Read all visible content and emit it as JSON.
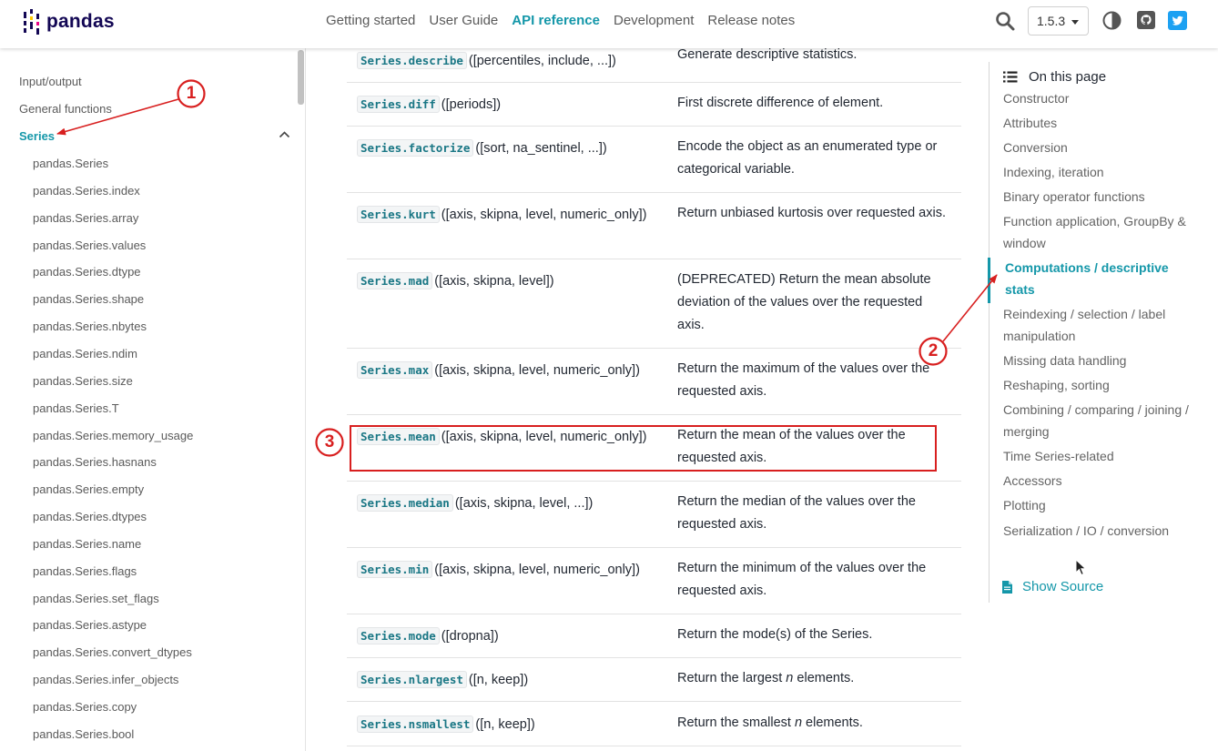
{
  "navbar": {
    "logo_text": "pandas",
    "links": [
      {
        "label": "Getting started",
        "active": false
      },
      {
        "label": "User Guide",
        "active": false
      },
      {
        "label": "API reference",
        "active": true
      },
      {
        "label": "Development",
        "active": false
      },
      {
        "label": "Release notes",
        "active": false
      }
    ],
    "version": "1.5.3"
  },
  "sidebar": {
    "top_items": [
      "Input/output",
      "General functions",
      "Series"
    ],
    "sub_items": [
      "pandas.Series",
      "pandas.Series.index",
      "pandas.Series.array",
      "pandas.Series.values",
      "pandas.Series.dtype",
      "pandas.Series.shape",
      "pandas.Series.nbytes",
      "pandas.Series.ndim",
      "pandas.Series.size",
      "pandas.Series.T",
      "pandas.Series.memory_usage",
      "pandas.Series.hasnans",
      "pandas.Series.empty",
      "pandas.Series.dtypes",
      "pandas.Series.name",
      "pandas.Series.flags",
      "pandas.Series.set_flags",
      "pandas.Series.astype",
      "pandas.Series.convert_dtypes",
      "pandas.Series.infer_objects",
      "pandas.Series.copy",
      "pandas.Series.bool"
    ]
  },
  "table": {
    "rows": [
      {
        "fn": "Series.describe",
        "args": "([percentiles, include, ...])",
        "desc": "Generate descriptive statistics."
      },
      {
        "fn": "Series.diff",
        "args": "([periods])",
        "desc": "First discrete difference of element."
      },
      {
        "fn": "Series.factorize",
        "args": "([sort, na_sentinel, ...])",
        "desc": "Encode the object as an enumerated type or categorical variable."
      },
      {
        "fn": "Series.kurt",
        "args": "([axis, skipna, level, numeric_only])",
        "desc": "Return unbiased kurtosis over requested axis."
      },
      {
        "fn": "Series.mad",
        "args": "([axis, skipna, level])",
        "desc": "(DEPRECATED) Return the mean absolute deviation of the values over the requested axis."
      },
      {
        "fn": "Series.max",
        "args": "([axis, skipna, level, numeric_only])",
        "desc": "Return the maximum of the values over the requested axis."
      },
      {
        "fn": "Series.mean",
        "args": "([axis, skipna, level, numeric_only])",
        "desc": "Return the mean of the values over the requested axis."
      },
      {
        "fn": "Series.median",
        "args": "([axis, skipna, level, ...])",
        "desc": "Return the median of the values over the requested axis."
      },
      {
        "fn": "Series.min",
        "args": "([axis, skipna, level, numeric_only])",
        "desc": "Return the minimum of the values over the requested axis."
      },
      {
        "fn": "Series.mode",
        "args": "([dropna])",
        "desc": "Return the mode(s) of the Series."
      },
      {
        "fn": "Series.nlargest",
        "args": "([n, keep])",
        "desc_pre": "Return the largest ",
        "desc_em": "n",
        "desc_post": " elements."
      },
      {
        "fn": "Series.nsmallest",
        "args": "([n, keep])",
        "desc_pre": "Return the smallest ",
        "desc_em": "n",
        "desc_post": " elements."
      }
    ]
  },
  "toc": {
    "heading": "On this page",
    "items": [
      "Constructor",
      "Attributes",
      "Conversion",
      "Indexing, iteration",
      "Binary operator functions",
      "Function application, GroupBy & window",
      "Computations / descriptive stats",
      "Reindexing / selection / label manipulation",
      "Missing data handling",
      "Reshaping, sorting",
      "Combining / comparing / joining / merging",
      "Time Series-related",
      "Accessors",
      "Plotting",
      "Serialization / IO / conversion"
    ],
    "active_index": 6,
    "show_source": "Show Source"
  },
  "annotations": {
    "labels": [
      "1",
      "2",
      "3"
    ],
    "color": "#d81f1f"
  },
  "colors": {
    "accent": "#1497a9",
    "brand": "#130754",
    "annotation": "#d81f1f"
  }
}
